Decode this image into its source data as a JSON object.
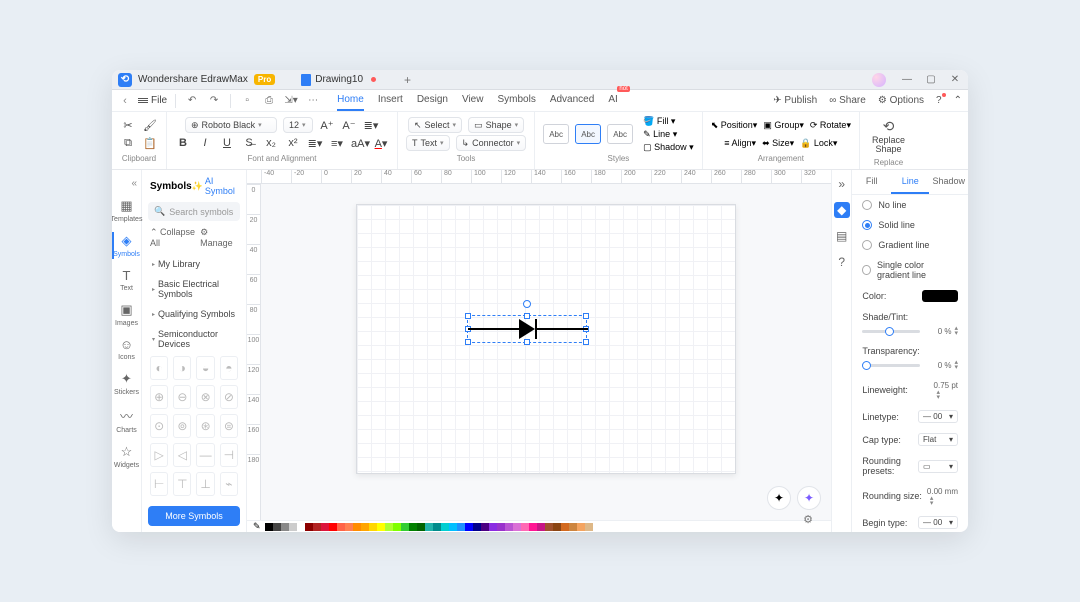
{
  "app": {
    "title": "Wondershare EdrawMax",
    "badge": "Pro",
    "tab": "Drawing10",
    "plus": "+"
  },
  "win": {
    "min": "—",
    "max": "▢",
    "close": "✕"
  },
  "menubar": {
    "file": "File",
    "tabs": [
      "Home",
      "Insert",
      "Design",
      "View",
      "Symbols",
      "Advanced",
      "AI"
    ],
    "hot": "hot",
    "right": {
      "publish": "Publish",
      "share": "Share",
      "options": "Options"
    }
  },
  "ribbon": {
    "clipboard": "Clipboard",
    "font": "Font and Alignment",
    "fontName": "Roboto Black",
    "fontSize": "12",
    "tools": "Tools",
    "select": "Select",
    "shape": "Shape",
    "text": "Text",
    "connector": "Connector",
    "styles": "Styles",
    "styleLbl": "Abc",
    "fill": "Fill",
    "line": "Line",
    "shadow": "Shadow",
    "arrangement": "Arrangement",
    "position": "Position",
    "group": "Group",
    "rotate": "Rotate",
    "align": "Align",
    "size": "Size",
    "lock": "Lock",
    "replaceShape": "Replace\nShape",
    "replace": "Replace"
  },
  "leftnav": {
    "items": [
      {
        "ic": "▦",
        "lbl": "Templates"
      },
      {
        "ic": "◈",
        "lbl": "Symbols"
      },
      {
        "ic": "T",
        "lbl": "Text"
      },
      {
        "ic": "▣",
        "lbl": "Images"
      },
      {
        "ic": "☺",
        "lbl": "Icons"
      },
      {
        "ic": "✦",
        "lbl": "Stickers"
      },
      {
        "ic": "〰",
        "lbl": "Charts"
      },
      {
        "ic": "☆",
        "lbl": "Widgets"
      }
    ]
  },
  "symbols": {
    "title": "Symbols",
    "ai": "AI Symbol",
    "search_ph": "Search symbols",
    "collapse": "Collapse All",
    "manage": "Manage",
    "cats": [
      "My Library",
      "Basic Electrical Symbols",
      "Qualifying Symbols",
      "Semiconductor Devices"
    ],
    "more": "More Symbols"
  },
  "ruler_h": [
    "-40",
    "-20",
    "0",
    "20",
    "40",
    "60",
    "80",
    "100",
    "120",
    "140",
    "160",
    "180",
    "200",
    "220",
    "240",
    "260",
    "280",
    "300",
    "320"
  ],
  "ruler_v": [
    "0",
    "20",
    "40",
    "60",
    "80",
    "100",
    "120",
    "140",
    "160",
    "180"
  ],
  "proptabs": [
    "Fill",
    "Line",
    "Shadow"
  ],
  "props": {
    "noLine": "No line",
    "solid": "Solid line",
    "grad": "Gradient line",
    "single": "Single color gradient line",
    "color": "Color:",
    "shade": "Shade/Tint:",
    "trans": "Transparency:",
    "zero": "0 %",
    "lwLbl": "Lineweight:",
    "lw": "0.75 pt",
    "ltLbl": "Linetype:",
    "lt": "— 00",
    "capLbl": "Cap type:",
    "cap": "Flat",
    "presetLbl": "Rounding presets:",
    "rszLbl": "Rounding size:",
    "rsz": "0.00 mm",
    "beginLbl": "Begin type:",
    "begin": "— 00"
  },
  "colors": [
    "#000",
    "#444",
    "#888",
    "#ccc",
    "#fff",
    "#8b0000",
    "#b22222",
    "#dc143c",
    "#ff0000",
    "#ff6347",
    "#ff7f50",
    "#ff8c00",
    "#ffa500",
    "#ffd700",
    "#ffff00",
    "#adff2f",
    "#7fff00",
    "#32cd32",
    "#008000",
    "#006400",
    "#20b2aa",
    "#008b8b",
    "#00ced1",
    "#00bfff",
    "#1e90ff",
    "#0000ff",
    "#00008b",
    "#4b0082",
    "#8a2be2",
    "#9932cc",
    "#ba55d3",
    "#da70d6",
    "#ff69b4",
    "#ff1493",
    "#c71585",
    "#a0522d",
    "#8b4513",
    "#d2691e",
    "#cd853f",
    "#f4a460",
    "#deb887"
  ]
}
